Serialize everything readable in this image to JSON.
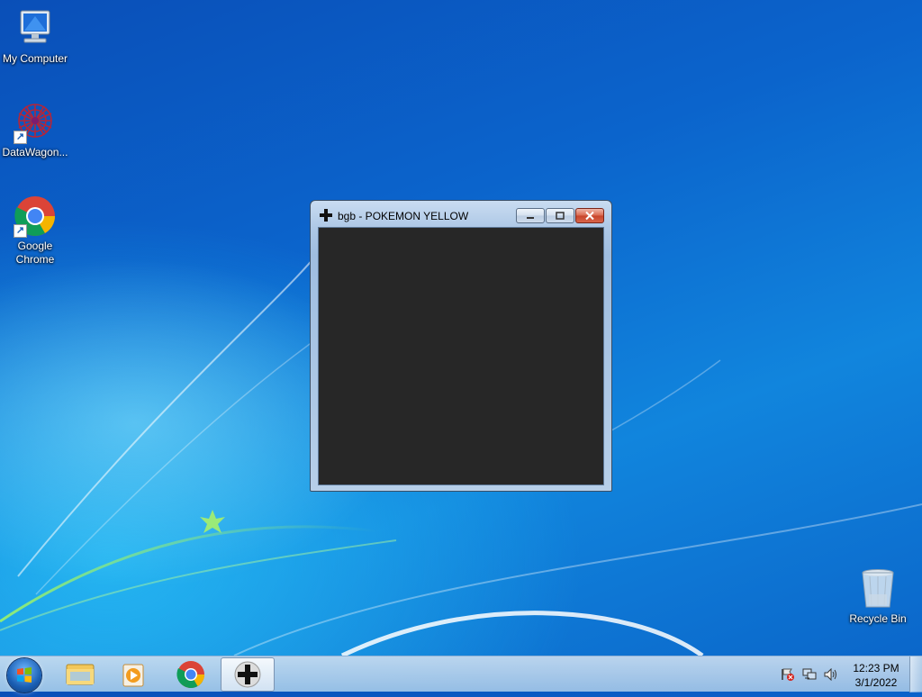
{
  "desktop": {
    "icons": [
      {
        "label": "My Computer",
        "icon": "computer-icon"
      },
      {
        "label": "DataWagon...",
        "icon": "datawagon-icon"
      },
      {
        "label": "Google Chrome",
        "icon": "chrome-icon"
      },
      {
        "label": "Recycle Bin",
        "icon": "recycle-bin-icon"
      }
    ]
  },
  "window": {
    "title": "bgb - POKEMON YELLOW",
    "icon": "gamepad-cross-icon",
    "client_color": "#272727"
  },
  "taskbar": {
    "items": [
      {
        "name": "start-orb",
        "icon": "windows-logo-icon"
      },
      {
        "name": "explorer",
        "icon": "folder-icon"
      },
      {
        "name": "media-player",
        "icon": "media-player-icon"
      },
      {
        "name": "chrome",
        "icon": "chrome-icon"
      },
      {
        "name": "bgb",
        "icon": "gamepad-cross-icon",
        "active": true
      }
    ],
    "tray": [
      "action-center-flag-icon",
      "network-icon",
      "volume-icon"
    ],
    "clock": {
      "time": "12:23 PM",
      "date": "3/1/2022"
    }
  }
}
